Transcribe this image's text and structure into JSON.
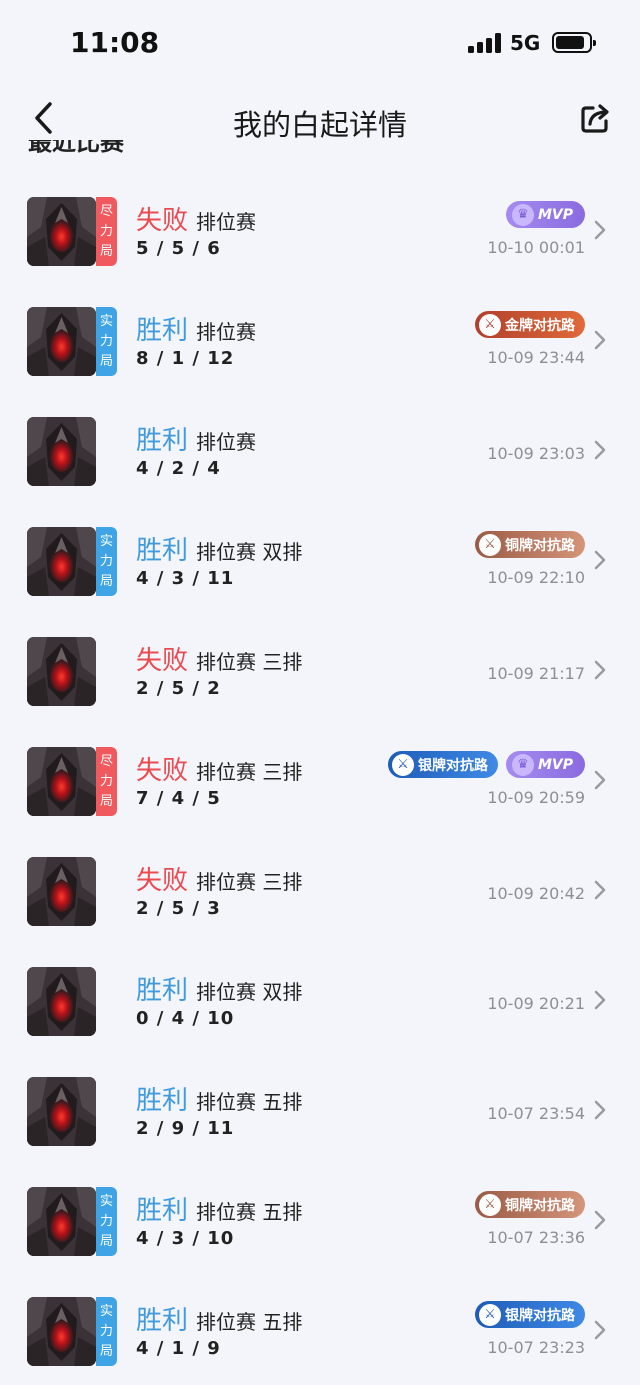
{
  "status_bar": {
    "time": "11:08",
    "network": "5G"
  },
  "nav": {
    "title": "我的白起详情"
  },
  "section": {
    "title": "最近比赛"
  },
  "matches": [
    {
      "result": "失败",
      "outcome": "lose",
      "mode": "排位赛",
      "kda": "5 / 5 / 6",
      "tag": [
        "尽",
        "力",
        "局"
      ],
      "tag_color": "red",
      "badges": [
        {
          "type": "mvp",
          "label": "MVP"
        }
      ],
      "date": "10-10 00:01"
    },
    {
      "result": "胜利",
      "outcome": "win",
      "mode": "排位赛",
      "kda": "8 / 1 / 12",
      "tag": [
        "实",
        "力",
        "局"
      ],
      "tag_color": "blue",
      "badges": [
        {
          "type": "gold",
          "label": "金牌对抗路"
        }
      ],
      "date": "10-09 23:44"
    },
    {
      "result": "胜利",
      "outcome": "win",
      "mode": "排位赛",
      "kda": "4 / 2 / 4",
      "tag": [],
      "tag_color": "",
      "badges": [],
      "date": "10-09 23:03"
    },
    {
      "result": "胜利",
      "outcome": "win",
      "mode": "排位赛 双排",
      "kda": "4 / 3 / 11",
      "tag": [
        "实",
        "力",
        "局"
      ],
      "tag_color": "blue",
      "badges": [
        {
          "type": "bronze",
          "label": "铜牌对抗路"
        }
      ],
      "date": "10-09 22:10"
    },
    {
      "result": "失败",
      "outcome": "lose",
      "mode": "排位赛 三排",
      "kda": "2 / 5 / 2",
      "tag": [],
      "tag_color": "",
      "badges": [],
      "date": "10-09 21:17"
    },
    {
      "result": "失败",
      "outcome": "lose",
      "mode": "排位赛 三排",
      "kda": "7 / 4 / 5",
      "tag": [
        "尽",
        "力",
        "局"
      ],
      "tag_color": "red",
      "badges": [
        {
          "type": "silver",
          "label": "银牌对抗路"
        },
        {
          "type": "mvp",
          "label": "MVP"
        }
      ],
      "date": "10-09 20:59"
    },
    {
      "result": "失败",
      "outcome": "lose",
      "mode": "排位赛 三排",
      "kda": "2 / 5 / 3",
      "tag": [],
      "tag_color": "",
      "badges": [],
      "date": "10-09 20:42"
    },
    {
      "result": "胜利",
      "outcome": "win",
      "mode": "排位赛 双排",
      "kda": "0 / 4 / 10",
      "tag": [],
      "tag_color": "",
      "badges": [],
      "date": "10-09 20:21"
    },
    {
      "result": "胜利",
      "outcome": "win",
      "mode": "排位赛 五排",
      "kda": "2 / 9 / 11",
      "tag": [],
      "tag_color": "",
      "badges": [],
      "date": "10-07 23:54"
    },
    {
      "result": "胜利",
      "outcome": "win",
      "mode": "排位赛 五排",
      "kda": "4 / 3 / 10",
      "tag": [
        "实",
        "力",
        "局"
      ],
      "tag_color": "blue",
      "badges": [
        {
          "type": "bronze",
          "label": "铜牌对抗路"
        }
      ],
      "date": "10-07 23:36"
    },
    {
      "result": "胜利",
      "outcome": "win",
      "mode": "排位赛 五排",
      "kda": "4 / 1 / 9",
      "tag": [
        "实",
        "力",
        "局"
      ],
      "tag_color": "blue",
      "badges": [
        {
          "type": "silver",
          "label": "银牌对抗路"
        }
      ],
      "date": "10-07 23:23"
    }
  ],
  "colors": {
    "win": "#3f9bde",
    "lose": "#ea4a50",
    "background": "#f4f5fa"
  },
  "icons": {
    "back": "chevron-left-icon",
    "share": "share-icon",
    "row_arrow": "chevron-right-icon"
  }
}
